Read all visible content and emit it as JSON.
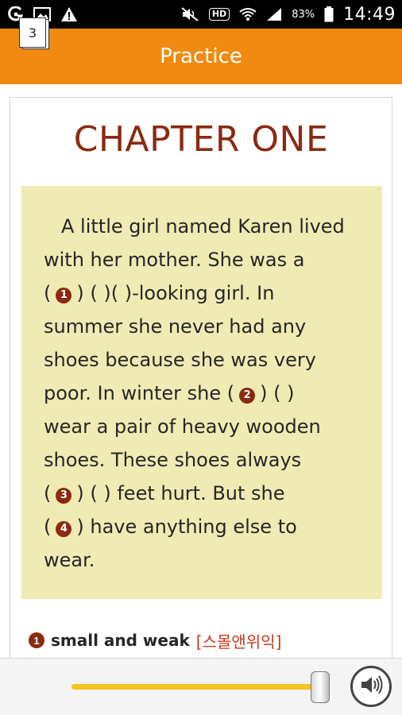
{
  "status_bar": {
    "icons_left": [
      "sync-icon",
      "image-icon",
      "warning-icon"
    ],
    "icons_right": [
      "mute-icon",
      "hd-badge",
      "wifi-icon",
      "signal-icon",
      "battery-icon"
    ],
    "hd_label": "HD",
    "battery_percent": "83%",
    "time": "14:49"
  },
  "header": {
    "title": "Practice"
  },
  "chapter": {
    "title": "CHAPTER ONE"
  },
  "passage": {
    "lines": [
      [
        "A little girl named Karen lived"
      ],
      [
        "with her mother. She was a"
      ],
      [
        "(",
        "1",
        ") (      )(       )-looking girl. In"
      ],
      [
        "summer she never had any"
      ],
      [
        "shoes because she was very"
      ],
      [
        "poor. In winter she (",
        "2",
        ") (      )"
      ],
      [
        "wear a pair of heavy wooden"
      ],
      [
        "shoes. These shoes always"
      ],
      [
        "(",
        "3",
        ") (      ) feet hurt. But she"
      ],
      [
        "(",
        "4",
        ") have anything else to"
      ],
      [
        "wear."
      ]
    ],
    "l1": "A little girl named Karen lived",
    "l2": "with her mother. She was a",
    "l3_pre": "(",
    "l3_num": "1",
    "l3_post": ") (      )(       )-looking girl. In",
    "l4": "summer she never had any",
    "l5": "shoes because she was very",
    "l6_pre": "poor. In winter she (",
    "l6_num": "2",
    "l6_post": ") (      )",
    "l7": "wear a pair of heavy wooden",
    "l8": "shoes. These shoes always",
    "l9_pre": "(",
    "l9_num": "3",
    "l9_post": ") (      ) feet hurt. But she",
    "l10_pre": "(",
    "l10_num": "4",
    "l10_post": ") have anything else to",
    "l11": "wear."
  },
  "answer": {
    "number": "1",
    "text": "small and weak",
    "hint": "[스몰앤위익]"
  },
  "bottom_bar": {
    "page_number": "3",
    "progress_fraction": 0.95
  },
  "colors": {
    "title_bar": "#f08a10",
    "chapter_title": "#8b2a10",
    "passage_bg": "#f0eab4",
    "slider_track": "#f3c321",
    "hint": "#c43a1c"
  }
}
